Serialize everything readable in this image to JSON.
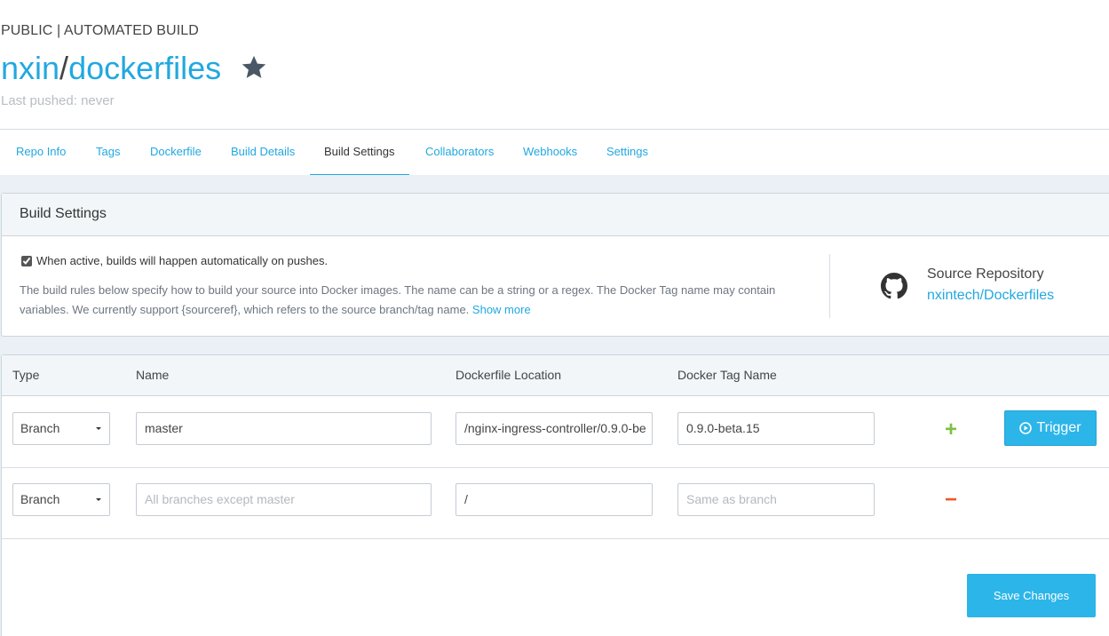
{
  "repo": {
    "kind": "PUBLIC | AUTOMATED BUILD",
    "owner": "nxin",
    "separator": "/",
    "name": "dockerfiles",
    "last_pushed": "Last pushed: never"
  },
  "tabs": [
    {
      "label": "Repo Info"
    },
    {
      "label": "Tags"
    },
    {
      "label": "Dockerfile"
    },
    {
      "label": "Build Details"
    },
    {
      "label": "Build Settings",
      "active": true
    },
    {
      "label": "Collaborators"
    },
    {
      "label": "Webhooks"
    },
    {
      "label": "Settings"
    }
  ],
  "build_settings": {
    "title": "Build Settings",
    "auto_build_label": "When active, builds will happen automatically on pushes.",
    "auto_build_checked": true,
    "description": "The build rules below specify how to build your source into Docker images. The name can be a string or a regex. The Docker Tag name may contain variables. We currently support {sourceref}, which refers to the source branch/tag name.",
    "show_more": "Show more",
    "source_label": "Source Repository",
    "source_link": "nxintech/Dockerfiles"
  },
  "rules": {
    "headers": {
      "type": "Type",
      "name": "Name",
      "dockerfile": "Dockerfile Location",
      "tag": "Docker Tag Name"
    },
    "rows": [
      {
        "type": "Branch",
        "name": "master",
        "name_placeholder": "",
        "dockerfile": "/nginx-ingress-controller/0.9.0-be",
        "tag": "0.9.0-beta.15",
        "tag_placeholder": "",
        "action": "+"
      },
      {
        "type": "Branch",
        "name": "",
        "name_placeholder": "All branches except master",
        "dockerfile": "/",
        "tag": "",
        "tag_placeholder": "Same as branch",
        "action": "−"
      }
    ],
    "trigger_label": "Trigger"
  },
  "save_label": "Save Changes",
  "colors": {
    "accent": "#22a8e0",
    "button": "#2cb5e8",
    "add": "#7ac143",
    "remove": "#ef5a24"
  }
}
